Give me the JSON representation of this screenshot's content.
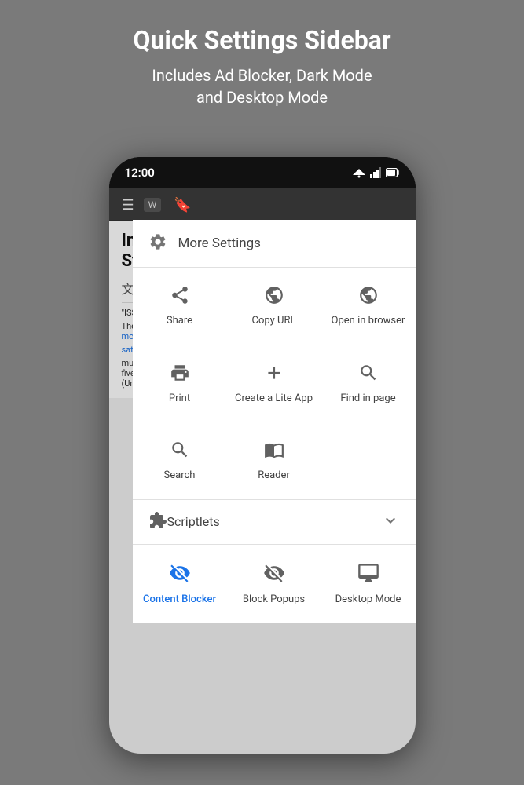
{
  "header": {
    "title": "Quick Settings Sidebar",
    "subtitle": "Includes Ad Blocker, Dark Mode\nand Desktop Mode"
  },
  "status_bar": {
    "time": "12:00"
  },
  "menu": {
    "header_label": "More Settings",
    "row1": [
      {
        "label": "Share",
        "icon": "share"
      },
      {
        "label": "Copy URL",
        "icon": "globe"
      },
      {
        "label": "Open in browser",
        "icon": "globe"
      }
    ],
    "row2": [
      {
        "label": "Print",
        "icon": "print"
      },
      {
        "label": "Create a Lite App",
        "icon": "plus"
      },
      {
        "label": "Find in page",
        "icon": "search"
      }
    ],
    "row3": [
      {
        "label": "Search",
        "icon": "search"
      },
      {
        "label": "Reader",
        "icon": "book"
      }
    ],
    "scriptlets_label": "Scriptlets",
    "row_bottom": [
      {
        "label": "Content Blocker",
        "icon": "content-blocker",
        "active": true
      },
      {
        "label": "Block Popups",
        "icon": "block-popups",
        "active": false
      },
      {
        "label": "Desktop Mode",
        "icon": "desktop",
        "active": false
      }
    ]
  },
  "page_content": {
    "title_part1": "Inte",
    "title_part2": "Stat",
    "disambiguation": "\"ISS\" re... (disamb)",
    "body_intro": "The Int",
    "link1": "modula",
    "link2": "satelli",
    "body2": "multina",
    "body3": "five pa",
    "body4": "(United"
  }
}
